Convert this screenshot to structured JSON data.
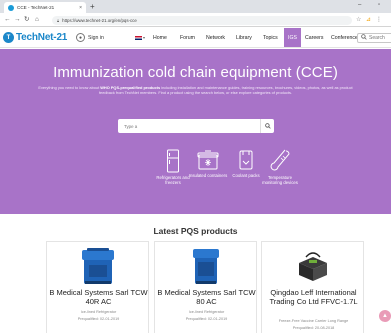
{
  "browser": {
    "tab_title": "CCE - TechNet-21",
    "tab_close": "×",
    "new_tab": "+",
    "url": "https://www.technet-21.org/en/pqs-cce",
    "win_minimize": "–",
    "win_restore": "▫"
  },
  "site": {
    "logo_mark": "T",
    "logo_text": "TechNet-21",
    "signin": "Sign in",
    "nav": [
      "Home",
      "Forum",
      "Network",
      "Library",
      "Topics",
      "IGS",
      "Careers",
      "Conference"
    ],
    "active_nav_index": 5,
    "search_placeholder": "Search"
  },
  "hero": {
    "title": "Immunization cold chain equipment (CCE)",
    "description_prefix": "Everything you need to know about ",
    "description_bold": "WHO PQS-prequalified products",
    "description_rest": " including installation and maintenance guides, training resources, brochures, videos, photos, as well as product feedback from TechNet members. Find a product using the search below, or else explore categories of products.",
    "search_placeholder": "Type a",
    "categories": [
      {
        "label": "Refrigerators and freezers",
        "icon": "refrigerator-icon"
      },
      {
        "label": "Insulated containers",
        "icon": "cold-box-icon"
      },
      {
        "label": "Coolant packs",
        "icon": "coolant-pack-icon"
      },
      {
        "label": "Temperature monitoring devices",
        "icon": "thermometer-icon"
      }
    ],
    "bg_color": "#a873c8"
  },
  "latest": {
    "heading": "Latest PQS products",
    "products": [
      {
        "name": "B Medical Systems Sarl TCW 40R AC",
        "type": "Ice-lined Refrigerator",
        "date": "Prequalified: 02-01-2019"
      },
      {
        "name": "B Medical Systems Sarl TCW 80 AC",
        "type": "Ice-lined Refrigerator",
        "date": "Prequalified: 02-01-2019"
      },
      {
        "name": "Qingdao Leff International Trading Co Ltd FFVC-1.7L",
        "type": "Freeze-Free Vaccine Carrier Long Range",
        "date": "Prequalified: 20-08-2018"
      }
    ]
  },
  "colors": {
    "brand_blue": "#1b87c9",
    "accent_purple": "#a873c8",
    "scroll_pink": "#e99bb7"
  }
}
